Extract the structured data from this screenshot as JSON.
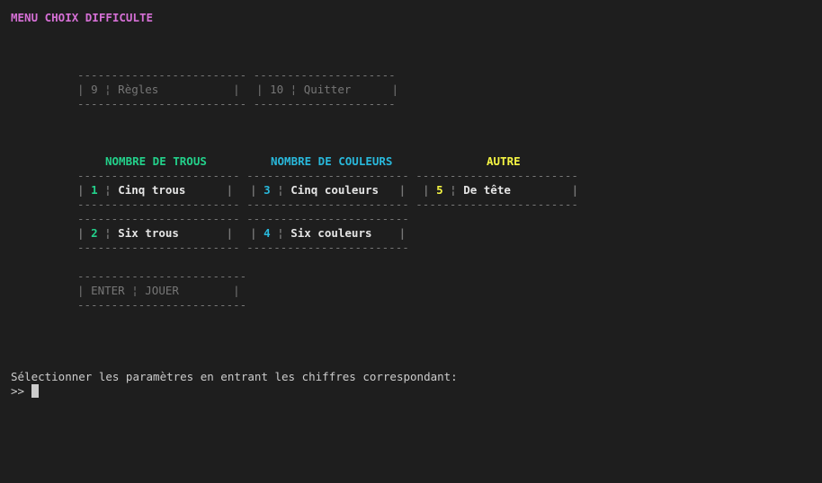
{
  "menu_title": "MENU CHOIX DIFFICULTE",
  "top_options": [
    {
      "key": "9",
      "label": "Règles"
    },
    {
      "key": "10",
      "label": "Quitter"
    }
  ],
  "columns": {
    "holes": {
      "header": "NOMBRE DE TROUS",
      "color": "#23d18b",
      "options": [
        {
          "key": "1",
          "label": "Cinq trous"
        },
        {
          "key": "2",
          "label": "Six trous"
        }
      ]
    },
    "colors": {
      "header": "NOMBRE DE COULEURS",
      "color": "#29b8db",
      "options": [
        {
          "key": "3",
          "label": "Cinq couleurs"
        },
        {
          "key": "4",
          "label": "Six couleurs"
        }
      ]
    },
    "other": {
      "header": "AUTRE",
      "color": "#f5f543",
      "options": [
        {
          "key": "5",
          "label": "De tête"
        }
      ]
    }
  },
  "play_option": {
    "key": "ENTER",
    "label": "JOUER"
  },
  "instruction": "Sélectionner les paramètres en entrant les chiffres correspondant:",
  "prompt": ">>"
}
